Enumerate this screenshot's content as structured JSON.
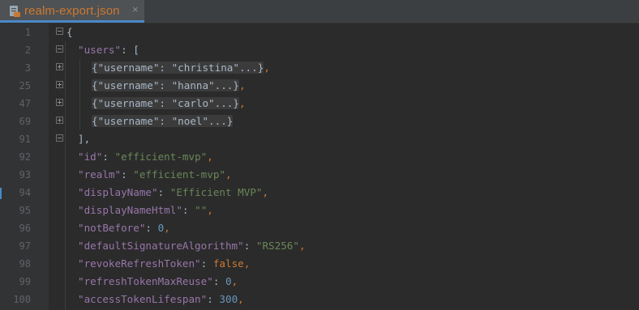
{
  "tab": {
    "filename": "realm-export.json",
    "close": "×",
    "icon": "json-file-icon"
  },
  "colors": {
    "background": "#2b2b2b",
    "gutter": "#313335",
    "key": "#9876aa",
    "string": "#6a8759",
    "number": "#6897bb",
    "keyword": "#cc7832",
    "text": "#a9b7c6"
  },
  "lines": [
    {
      "n": "1",
      "fold": "open",
      "open": "{"
    },
    {
      "n": "2",
      "fold": "open",
      "key": "\"users\"",
      "sep": ": ",
      "open": "["
    },
    {
      "n": "3",
      "fold": "closed",
      "collapsed": "{\"username\": \"christina\"...}",
      "trail": ","
    },
    {
      "n": "25",
      "fold": "closed",
      "collapsed": "{\"username\": \"hanna\"...}",
      "trail": ","
    },
    {
      "n": "47",
      "fold": "closed",
      "collapsed": "{\"username\": \"carlo\"...}",
      "trail": ","
    },
    {
      "n": "69",
      "fold": "closed",
      "collapsed": "{\"username\": \"noel\"...}",
      "trail": ""
    },
    {
      "n": "91",
      "fold": "end",
      "close": "],"
    },
    {
      "n": "92",
      "key": "\"id\"",
      "sep": ": ",
      "str": "\"efficient-mvp\"",
      "trail": ","
    },
    {
      "n": "93",
      "key": "\"realm\"",
      "sep": ": ",
      "str": "\"efficient-mvp\"",
      "trail": ","
    },
    {
      "n": "94",
      "key": "\"displayName\"",
      "sep": ": ",
      "str": "\"Efficient MVP\"",
      "trail": ","
    },
    {
      "n": "95",
      "key": "\"displayNameHtml\"",
      "sep": ": ",
      "str": "\"\"",
      "trail": ","
    },
    {
      "n": "96",
      "key": "\"notBefore\"",
      "sep": ": ",
      "num": "0",
      "trail": ","
    },
    {
      "n": "97",
      "key": "\"defaultSignatureAlgorithm\"",
      "sep": ": ",
      "str": "\"RS256\"",
      "trail": ","
    },
    {
      "n": "98",
      "key": "\"revokeRefreshToken\"",
      "sep": ": ",
      "kw": "false",
      "trail": ","
    },
    {
      "n": "99",
      "key": "\"refreshTokenMaxReuse\"",
      "sep": ": ",
      "num": "0",
      "trail": ","
    },
    {
      "n": "100",
      "key": "\"accessTokenLifespan\"",
      "sep": ": ",
      "num": "300",
      "trail": ","
    }
  ]
}
